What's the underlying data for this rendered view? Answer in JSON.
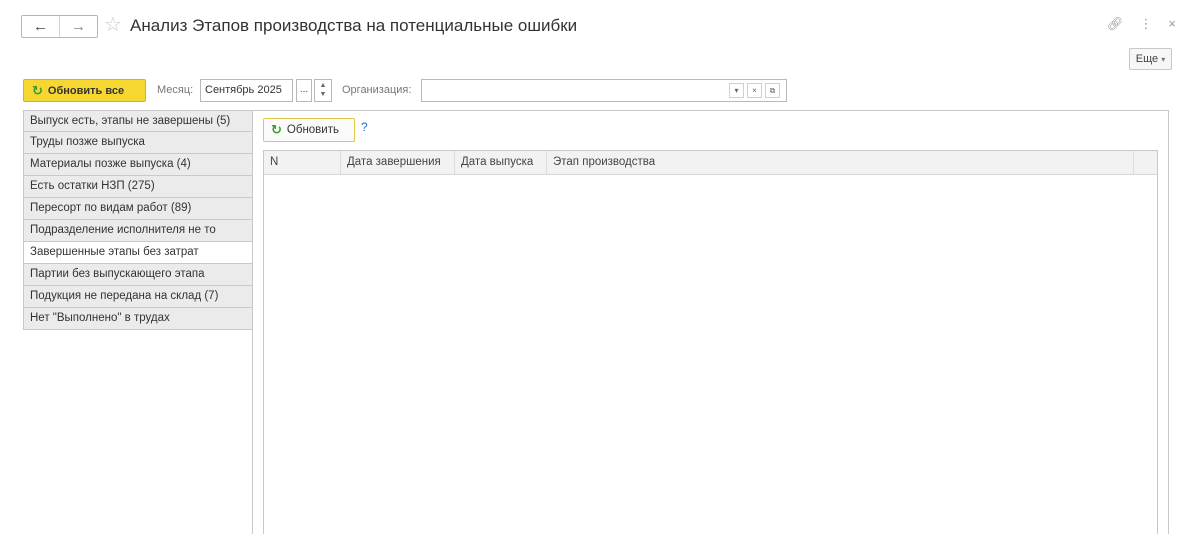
{
  "window": {
    "title": "Анализ Этапов производства на потенциальные ошибки",
    "nav_back": "←",
    "nav_forward": "→",
    "star_icon": "star-icon",
    "more_label": "Еще"
  },
  "toolbar": {
    "refresh_all_label": "Обновить все",
    "month_label": "Месяц:",
    "month_value": "Сентябрь 2025",
    "dots_label": "...",
    "organization_label": "Организация:",
    "organization_value": ""
  },
  "sidebar": {
    "items": [
      {
        "label": "Выпуск есть, этапы не завершены (5)"
      },
      {
        "label": "Труды позже выпуска"
      },
      {
        "label": "Материалы позже выпуска (4)"
      },
      {
        "label": "Есть остатки НЗП (275)"
      },
      {
        "label": "Пересорт по видам работ (89)"
      },
      {
        "label": "Подразделение исполнителя не то"
      },
      {
        "label": "Завершенные этапы без затрат"
      },
      {
        "label": "Партии без выпускающего этапа"
      },
      {
        "label": "Подукция не передана на склад (7)"
      },
      {
        "label": "Нет \"Выполнено\" в трудах"
      }
    ],
    "active_index": 6
  },
  "panel": {
    "refresh_label": "Обновить",
    "help_label": "?",
    "columns": [
      "N",
      "Дата завершения",
      "Дата выпуска",
      "Этап производства"
    ],
    "rows": []
  },
  "colors": {
    "accent_yellow": "#f6d732",
    "refresh_green": "#3a9a2c",
    "link_blue": "#1a6fd1"
  }
}
